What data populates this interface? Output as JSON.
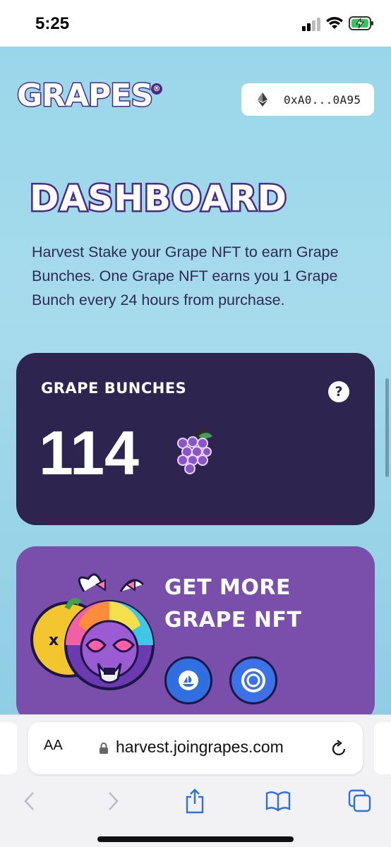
{
  "status_bar": {
    "time": "5:25"
  },
  "header": {
    "logo_text": "GRAPES",
    "logo_registered": "®",
    "wallet_address": "0xA0...0A95"
  },
  "dashboard": {
    "title": "DASHBOARD",
    "description": "Harvest Stake your Grape NFT to earn Grape Bunches. One Grape NFT earns you 1 Grape Bunch every 24 hours from purchase."
  },
  "bunches_card": {
    "label": "GRAPE BUNCHES",
    "help": "?",
    "value": "114"
  },
  "more_card": {
    "title_line1": "GET MORE",
    "title_line2": "GRAPE NFT"
  },
  "browser": {
    "text_size_label": "AA",
    "url": "harvest.joingrapes.com"
  },
  "colors": {
    "page_bg": "#9ad6ea",
    "brand_purple": "#4b2b86",
    "card_dark": "#2d2550",
    "card_purple": "#7a4fab",
    "market_blue": "#2f6fe0"
  }
}
